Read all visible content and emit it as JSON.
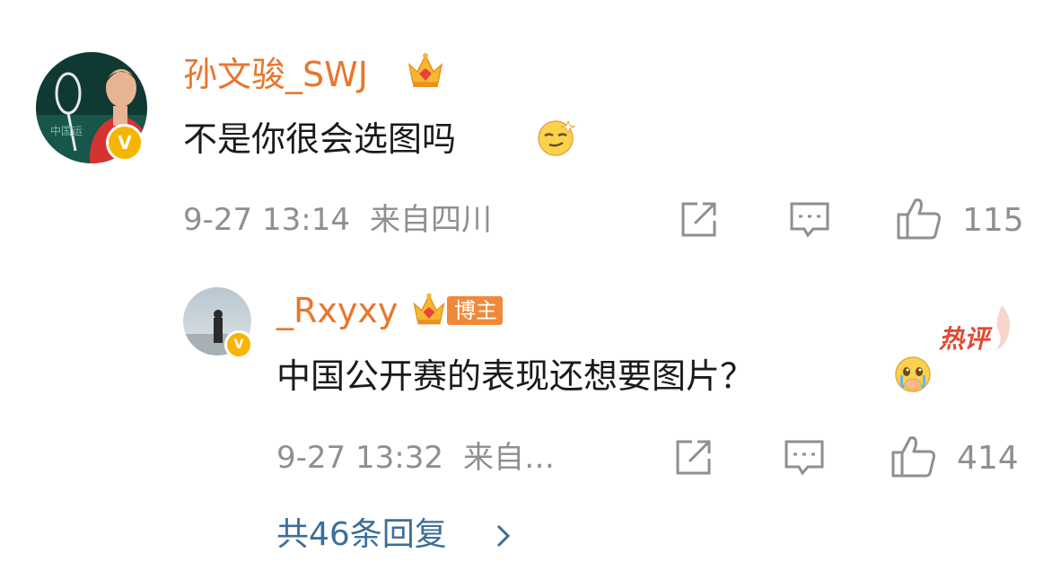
{
  "comment": {
    "author": "孙文骏_SWJ",
    "author_badge_icon": "crown-icon",
    "verified_badge": "V",
    "text": "不是你很会选图吗",
    "emoji": "smirk-emoji",
    "time": "9-27 13:14",
    "location": "来自四川",
    "likes": "115",
    "actions": [
      "share-icon",
      "comment-icon",
      "like-icon"
    ]
  },
  "reply": {
    "author": "_Rxyxy",
    "author_badge_icon": "crown-icon",
    "blogger_label": "博主",
    "verified_badge": "V",
    "hot_label": "热评",
    "text": "中国公开赛的表现还想要图片？",
    "emoji": "crying-emoji",
    "time": "9-27 13:32",
    "location": "来自…",
    "likes": "414"
  },
  "replies_link": "共46条回复",
  "colors": {
    "name": "#e8762c",
    "link": "#3d6e98",
    "meta": "#8f8f8f",
    "badge": "#f7b500",
    "hot": "#e04a34"
  }
}
